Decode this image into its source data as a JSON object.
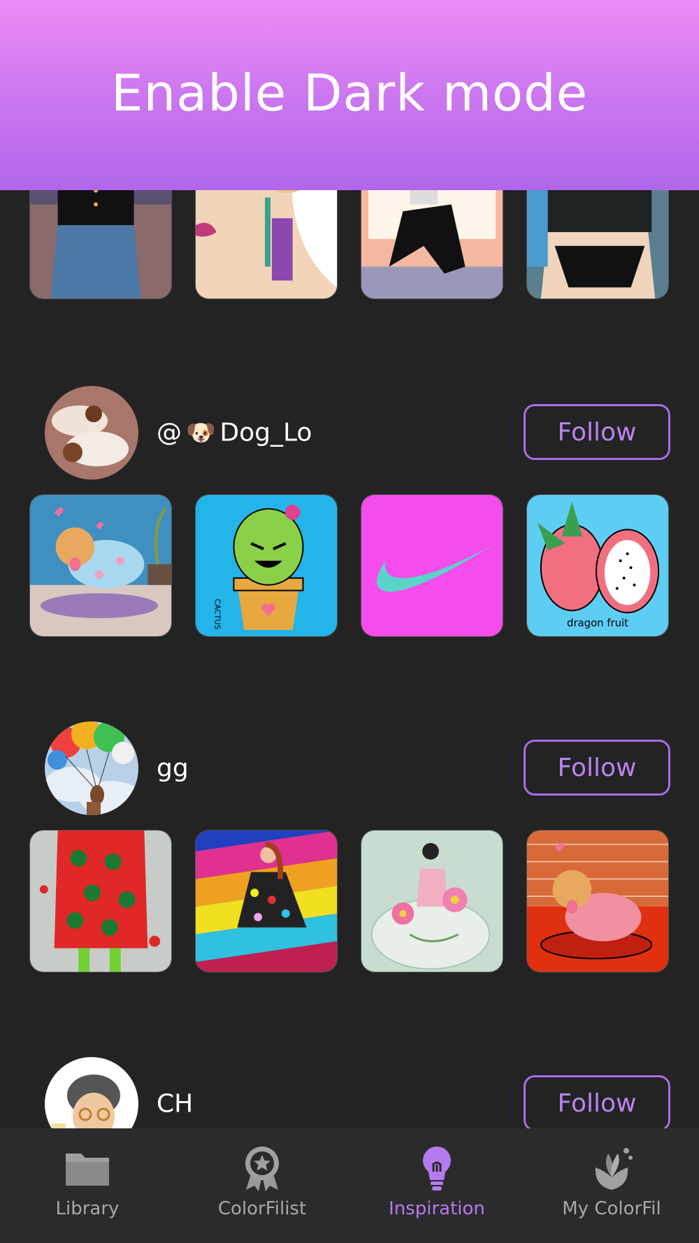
{
  "banner": {
    "title": "Enable Dark mode"
  },
  "top_row": [
    {
      "name": "fashion-art-denim"
    },
    {
      "name": "fashion-art-earring"
    },
    {
      "name": "fashion-art-fishnet"
    },
    {
      "name": "fashion-art-swimsuit"
    }
  ],
  "users": [
    {
      "username_prefix": "@",
      "username_emoji": "🐶",
      "username": "Dog_Lo",
      "follow_label": "Follow",
      "artworks": [
        "dog-pajamas",
        "cactus",
        "swoosh-logo",
        "dragon-fruit"
      ],
      "artwork_texts": {
        "cactus": "CACTUS",
        "dragon_fruit": "dragon fruit"
      }
    },
    {
      "username": "gg",
      "follow_label": "Follow",
      "artworks": [
        "christmas-dress",
        "rainbow-dress",
        "flower-gown",
        "dog-brick-wall"
      ]
    },
    {
      "username": "CH",
      "follow_label": "Follow"
    }
  ],
  "tabbar": {
    "items": [
      {
        "label": "Library",
        "icon": "folder-icon",
        "active": false
      },
      {
        "label": "ColorFilist",
        "icon": "award-badge-icon",
        "active": false
      },
      {
        "label": "Inspiration",
        "icon": "lightbulb-icon",
        "active": true
      },
      {
        "label": "My ColorFil",
        "icon": "flower-bud-icon",
        "active": false
      }
    ]
  },
  "colors": {
    "background": "#232323",
    "accent": "#b57af0",
    "banner_top": "#ec8cf7",
    "banner_bottom": "#b166eb",
    "tab_inactive": "#a8a8a8"
  }
}
